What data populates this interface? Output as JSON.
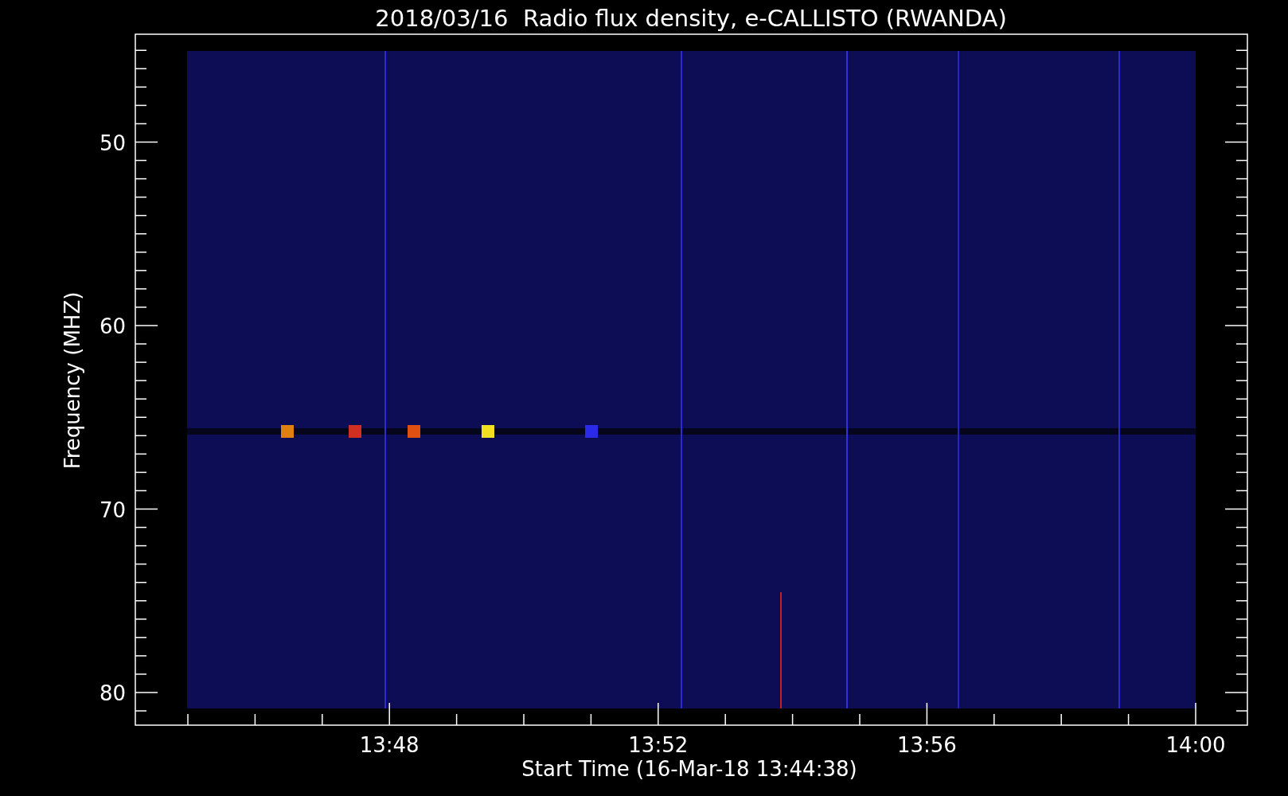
{
  "title": "2018/03/16  Radio flux density, e-CALLISTO (RWANDA)",
  "y_axis": {
    "label": "Frequency (MHZ)",
    "ticks": [
      "50",
      "60",
      "70",
      "80"
    ]
  },
  "x_axis": {
    "label": "Start Time (16-Mar-18 13:44:38)",
    "ticks": [
      "13:48",
      "13:52",
      "13:56",
      "14:00"
    ]
  }
}
